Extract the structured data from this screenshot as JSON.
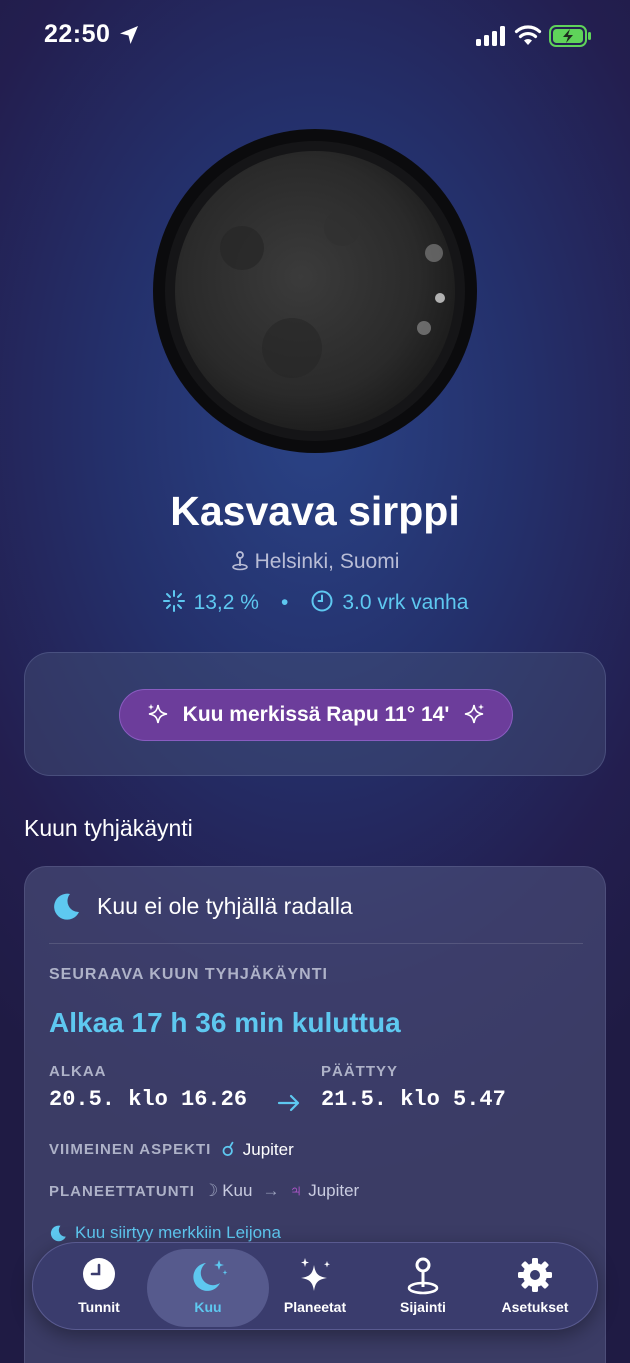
{
  "status_bar": {
    "time": "22:50"
  },
  "moon": {
    "phase_name": "Kasvava sirppi",
    "location": "Helsinki, Suomi",
    "illumination": "13,2 %",
    "separator": "•",
    "age": "3.0 vrk vanha"
  },
  "zodiac": {
    "label": "Kuu merkissä Rapu 11° 14'"
  },
  "void_section": {
    "heading": "Kuun tyhjäkäynti",
    "status": "Kuu ei ole tyhjällä radalla",
    "next_label": "SEURAAVA KUUN TYHJÄKÄYNTI",
    "countdown": "Alkaa 17 h 36 min kuluttua",
    "start_label": "ALKAA",
    "start_value": "20.5. klo 16.26",
    "end_label": "PÄÄTTYY",
    "end_value": "21.5. klo 5.47",
    "last_aspect_label": "VIIMEINEN ASPEKTI",
    "last_aspect_glyph": "☌",
    "last_aspect_value": "Jupiter",
    "planet_hour_label": "PLANEETTATUNTI",
    "planet_hour_from_glyph": "☽",
    "planet_hour_from": "Kuu",
    "planet_hour_arrow": "→",
    "planet_hour_to_glyph": "♃",
    "planet_hour_to": "Jupiter",
    "sign_change": "Kuu siirtyy merkkiin Leijona"
  },
  "tabs": [
    {
      "label": "Tunnit",
      "icon": "clock-icon"
    },
    {
      "label": "Kuu",
      "icon": "moon-stars-icon",
      "active": true
    },
    {
      "label": "Planeetat",
      "icon": "sparkles-icon"
    },
    {
      "label": "Sijainti",
      "icon": "location-pin-icon"
    },
    {
      "label": "Asetukset",
      "icon": "gear-icon"
    }
  ],
  "colors": {
    "accent": "#5ec8f0",
    "zodiac_pill": "#6c3d9b",
    "background": "#24306b"
  }
}
